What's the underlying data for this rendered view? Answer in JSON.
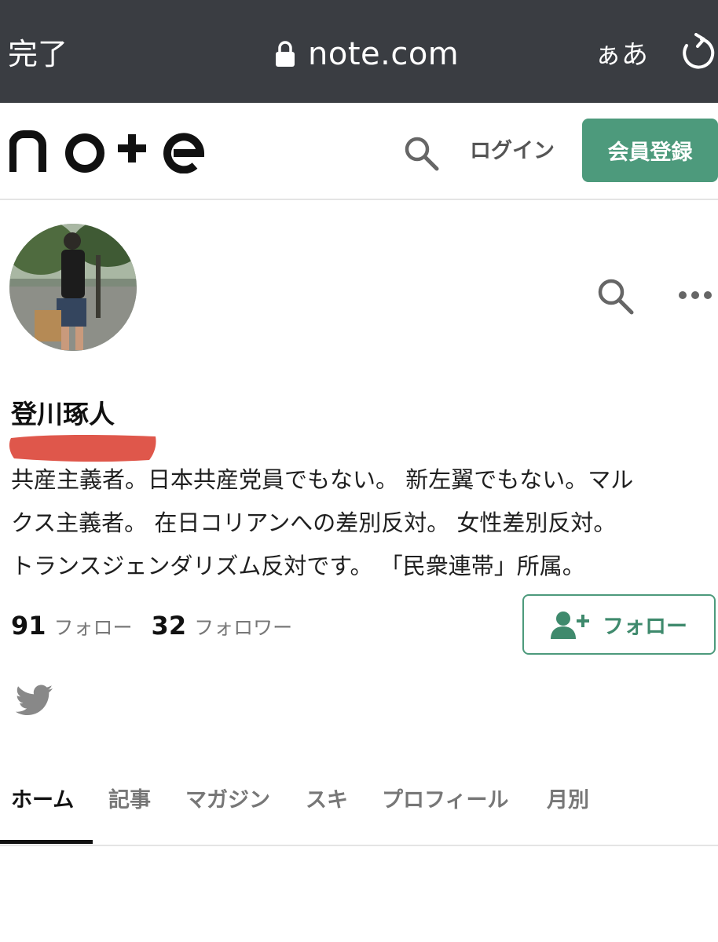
{
  "browser": {
    "done_label": "完了",
    "url": "note.com",
    "text_size_label": "ぁあ"
  },
  "header": {
    "logo_text": "note",
    "login_label": "ログイン",
    "register_label": "会員登録"
  },
  "profile": {
    "name": "登川琢人",
    "bio_lines": [
      "共産主義者。日本共産党員でもない。 新左翼でもない。マル",
      "クス主義者。 在日コリアンへの差別反対。 女性差別反対。",
      "トランスジェンダリズム反対です。 「民衆連帯」所属。"
    ],
    "following_count": "91",
    "following_label": "フォロー",
    "followers_count": "32",
    "followers_label": "フォロワー",
    "follow_button_label": "フォロー"
  },
  "tabs": [
    {
      "label": "ホーム",
      "active": true
    },
    {
      "label": "記事",
      "active": false
    },
    {
      "label": "マガジン",
      "active": false
    },
    {
      "label": "スキ",
      "active": false
    },
    {
      "label": "プロフィール",
      "active": false
    },
    {
      "label": "月別",
      "active": false
    }
  ],
  "colors": {
    "browser_bar": "#3a3d42",
    "brand_green": "#4d9a7c",
    "redaction": "#d93a2b"
  },
  "icons": {
    "lock": "lock-icon",
    "reload": "reload-icon",
    "search": "search-icon",
    "more": "more-horizontal-icon",
    "follow": "add-user-icon",
    "twitter": "twitter-icon"
  }
}
